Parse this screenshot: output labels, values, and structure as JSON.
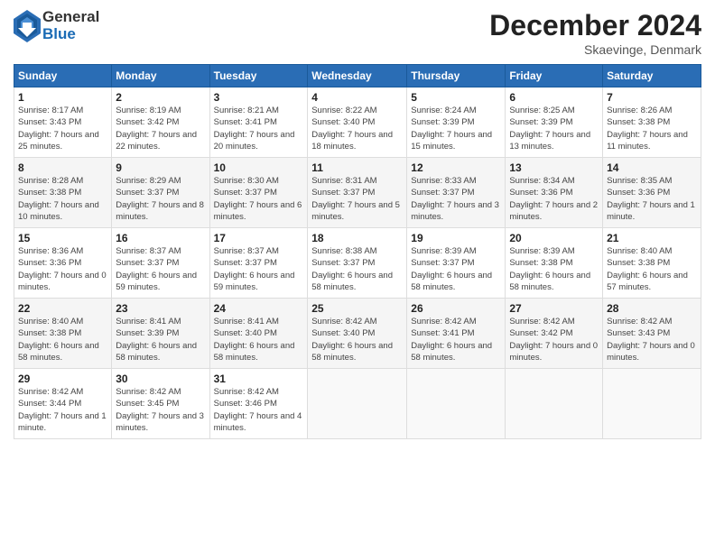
{
  "logo": {
    "general": "General",
    "blue": "Blue"
  },
  "title": {
    "month": "December 2024",
    "location": "Skaevinge, Denmark"
  },
  "weekdays": [
    "Sunday",
    "Monday",
    "Tuesday",
    "Wednesday",
    "Thursday",
    "Friday",
    "Saturday"
  ],
  "weeks": [
    [
      {
        "day": "1",
        "sunrise": "8:17 AM",
        "sunset": "3:43 PM",
        "daylight": "7 hours and 25 minutes."
      },
      {
        "day": "2",
        "sunrise": "8:19 AM",
        "sunset": "3:42 PM",
        "daylight": "7 hours and 22 minutes."
      },
      {
        "day": "3",
        "sunrise": "8:21 AM",
        "sunset": "3:41 PM",
        "daylight": "7 hours and 20 minutes."
      },
      {
        "day": "4",
        "sunrise": "8:22 AM",
        "sunset": "3:40 PM",
        "daylight": "7 hours and 18 minutes."
      },
      {
        "day": "5",
        "sunrise": "8:24 AM",
        "sunset": "3:39 PM",
        "daylight": "7 hours and 15 minutes."
      },
      {
        "day": "6",
        "sunrise": "8:25 AM",
        "sunset": "3:39 PM",
        "daylight": "7 hours and 13 minutes."
      },
      {
        "day": "7",
        "sunrise": "8:26 AM",
        "sunset": "3:38 PM",
        "daylight": "7 hours and 11 minutes."
      }
    ],
    [
      {
        "day": "8",
        "sunrise": "8:28 AM",
        "sunset": "3:38 PM",
        "daylight": "7 hours and 10 minutes."
      },
      {
        "day": "9",
        "sunrise": "8:29 AM",
        "sunset": "3:37 PM",
        "daylight": "7 hours and 8 minutes."
      },
      {
        "day": "10",
        "sunrise": "8:30 AM",
        "sunset": "3:37 PM",
        "daylight": "7 hours and 6 minutes."
      },
      {
        "day": "11",
        "sunrise": "8:31 AM",
        "sunset": "3:37 PM",
        "daylight": "7 hours and 5 minutes."
      },
      {
        "day": "12",
        "sunrise": "8:33 AM",
        "sunset": "3:37 PM",
        "daylight": "7 hours and 3 minutes."
      },
      {
        "day": "13",
        "sunrise": "8:34 AM",
        "sunset": "3:36 PM",
        "daylight": "7 hours and 2 minutes."
      },
      {
        "day": "14",
        "sunrise": "8:35 AM",
        "sunset": "3:36 PM",
        "daylight": "7 hours and 1 minute."
      }
    ],
    [
      {
        "day": "15",
        "sunrise": "8:36 AM",
        "sunset": "3:36 PM",
        "daylight": "7 hours and 0 minutes."
      },
      {
        "day": "16",
        "sunrise": "8:37 AM",
        "sunset": "3:37 PM",
        "daylight": "6 hours and 59 minutes."
      },
      {
        "day": "17",
        "sunrise": "8:37 AM",
        "sunset": "3:37 PM",
        "daylight": "6 hours and 59 minutes."
      },
      {
        "day": "18",
        "sunrise": "8:38 AM",
        "sunset": "3:37 PM",
        "daylight": "6 hours and 58 minutes."
      },
      {
        "day": "19",
        "sunrise": "8:39 AM",
        "sunset": "3:37 PM",
        "daylight": "6 hours and 58 minutes."
      },
      {
        "day": "20",
        "sunrise": "8:39 AM",
        "sunset": "3:38 PM",
        "daylight": "6 hours and 58 minutes."
      },
      {
        "day": "21",
        "sunrise": "8:40 AM",
        "sunset": "3:38 PM",
        "daylight": "6 hours and 57 minutes."
      }
    ],
    [
      {
        "day": "22",
        "sunrise": "8:40 AM",
        "sunset": "3:38 PM",
        "daylight": "6 hours and 58 minutes."
      },
      {
        "day": "23",
        "sunrise": "8:41 AM",
        "sunset": "3:39 PM",
        "daylight": "6 hours and 58 minutes."
      },
      {
        "day": "24",
        "sunrise": "8:41 AM",
        "sunset": "3:40 PM",
        "daylight": "6 hours and 58 minutes."
      },
      {
        "day": "25",
        "sunrise": "8:42 AM",
        "sunset": "3:40 PM",
        "daylight": "6 hours and 58 minutes."
      },
      {
        "day": "26",
        "sunrise": "8:42 AM",
        "sunset": "3:41 PM",
        "daylight": "6 hours and 58 minutes."
      },
      {
        "day": "27",
        "sunrise": "8:42 AM",
        "sunset": "3:42 PM",
        "daylight": "7 hours and 0 minutes."
      },
      {
        "day": "28",
        "sunrise": "8:42 AM",
        "sunset": "3:43 PM",
        "daylight": "7 hours and 0 minutes."
      }
    ],
    [
      {
        "day": "29",
        "sunrise": "8:42 AM",
        "sunset": "3:44 PM",
        "daylight": "7 hours and 1 minute."
      },
      {
        "day": "30",
        "sunrise": "8:42 AM",
        "sunset": "3:45 PM",
        "daylight": "7 hours and 3 minutes."
      },
      {
        "day": "31",
        "sunrise": "8:42 AM",
        "sunset": "3:46 PM",
        "daylight": "7 hours and 4 minutes."
      },
      null,
      null,
      null,
      null
    ]
  ]
}
